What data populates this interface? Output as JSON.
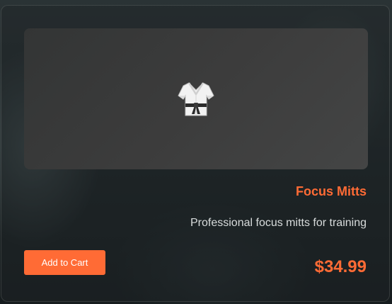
{
  "product": {
    "image_icon": "martial-arts-uniform-icon",
    "name": "Focus Mitts",
    "description": "Professional focus mitts for training",
    "price": "$34.99",
    "add_to_cart_label": "Add to Cart"
  },
  "colors": {
    "accent": "#ff6b35",
    "text_muted": "#d8dcdc",
    "image_bg": "#3c3c3c"
  }
}
